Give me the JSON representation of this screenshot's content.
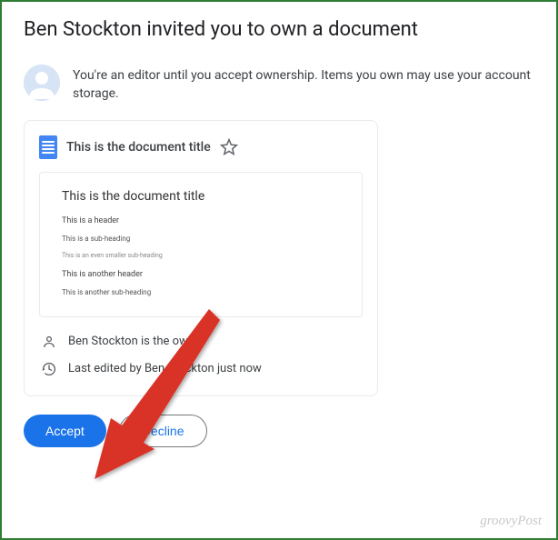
{
  "title": "Ben Stockton invited you to own a document",
  "info_text": "You're an editor until you accept ownership. Items you own may use your account storage.",
  "card": {
    "doc_title": "This is the document title",
    "preview": {
      "title": "This is the document title",
      "lines": [
        "This is a header",
        "This is a sub-heading",
        "This is an even smaller sub-heading",
        "This is another header",
        "This is another sub-heading"
      ]
    },
    "owner_text": "Ben Stockton is the owner",
    "edited_text": "Last edited by Ben Stockton just now"
  },
  "buttons": {
    "accept": "Accept",
    "decline": "Decline"
  },
  "watermark": "groovyPost"
}
